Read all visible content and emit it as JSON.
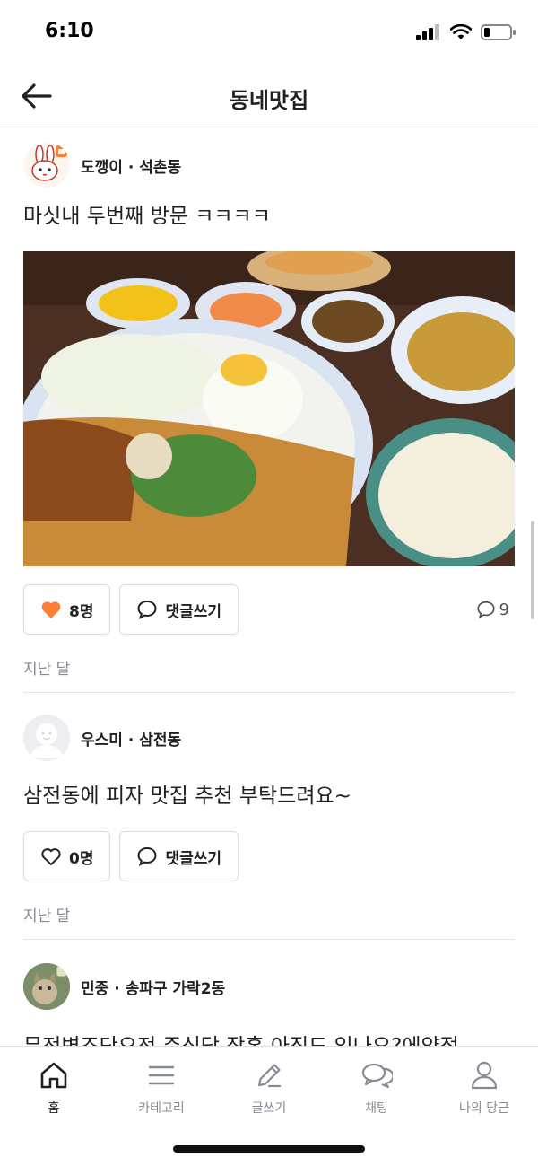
{
  "status": {
    "time": "6:10"
  },
  "header": {
    "title": "동네맛집"
  },
  "posts": [
    {
      "author": "도깽이 · 석촌동",
      "text": "마싯내 두번째 방문 ㅋㅋㅋㅋ",
      "like_label": "8명",
      "comment_button": "댓글쓰기",
      "comment_count": "9",
      "time": "지난 달"
    },
    {
      "author": "우스미 · 삼전동",
      "text": "삼전동에 피자 맛집 추천 부탁드려요~",
      "like_label": "0명",
      "comment_button": "댓글쓰기",
      "time": "지난 달"
    },
    {
      "author": "민중 · 송파구 가락2동",
      "text": "무전변조단오전 주식당 작홍 아직도 있나요?에약적"
    }
  ],
  "tabs": [
    {
      "label": "홈",
      "icon": "home-icon"
    },
    {
      "label": "카테고리",
      "icon": "menu-icon"
    },
    {
      "label": "글쓰기",
      "icon": "pencil-icon"
    },
    {
      "label": "채팅",
      "icon": "chat-icon"
    },
    {
      "label": "나의 당근",
      "icon": "person-icon"
    }
  ],
  "colors": {
    "heart": "#ff7e36",
    "accent_text": "#212124",
    "muted": "#868b94"
  }
}
